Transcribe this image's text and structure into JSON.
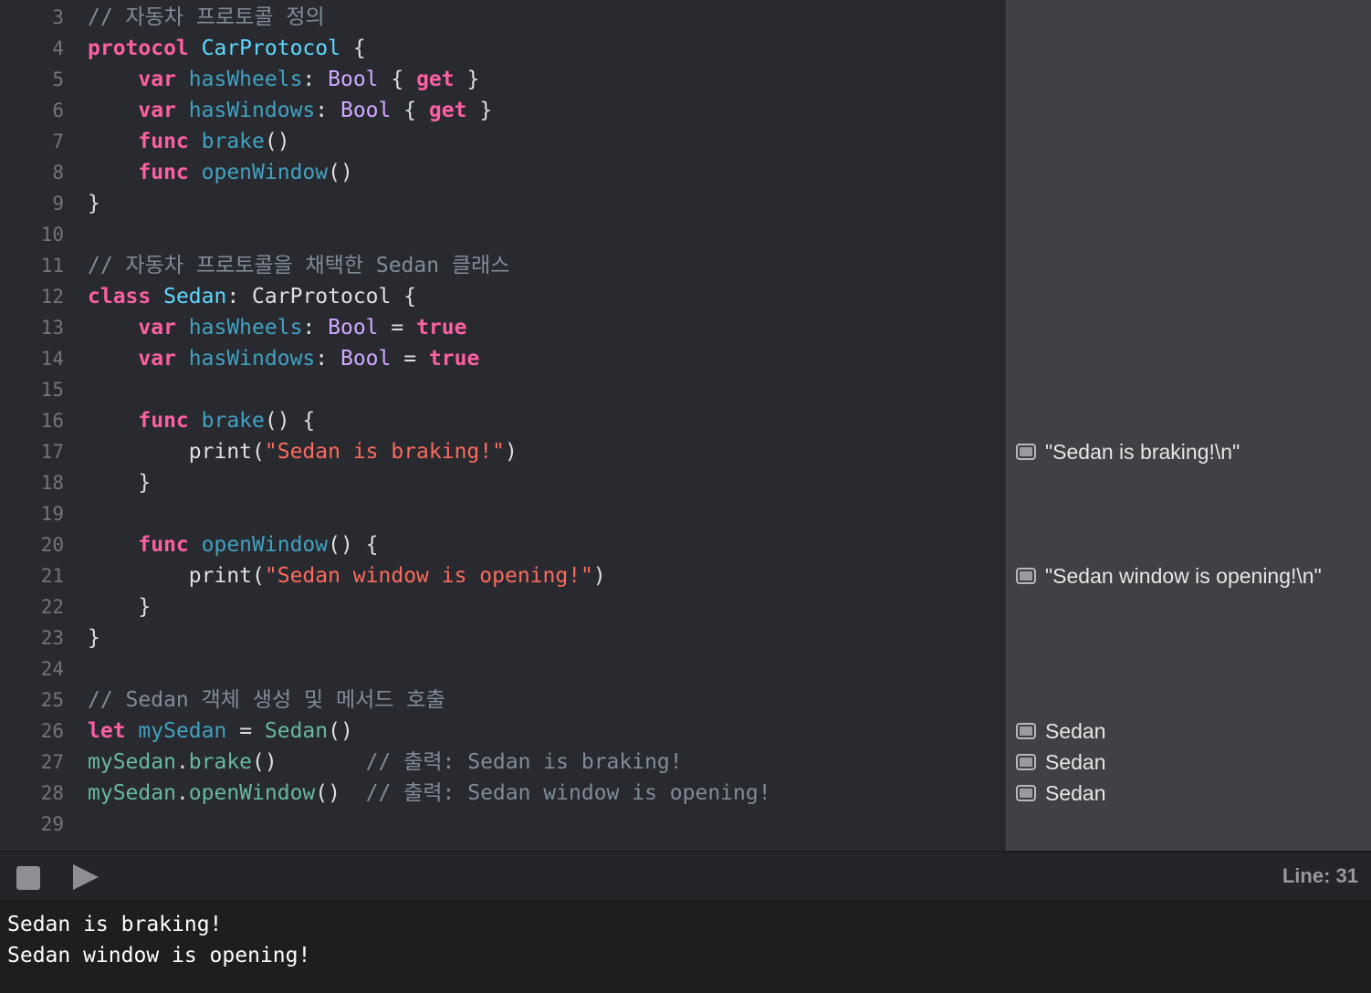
{
  "editor": {
    "lines": [
      {
        "num": "3",
        "tokens": [
          {
            "t": "// 자동차 프로토콜 정의",
            "c": "comment"
          }
        ]
      },
      {
        "num": "4",
        "tokens": [
          {
            "t": "protocol",
            "c": "kw"
          },
          {
            "t": " ",
            "c": "plain"
          },
          {
            "t": "CarProtocol",
            "c": "type"
          },
          {
            "t": " {",
            "c": "plain"
          }
        ]
      },
      {
        "num": "5",
        "tokens": [
          {
            "t": "    ",
            "c": "plain"
          },
          {
            "t": "var",
            "c": "kw"
          },
          {
            "t": " ",
            "c": "plain"
          },
          {
            "t": "hasWheels",
            "c": "prop"
          },
          {
            "t": ": ",
            "c": "plain"
          },
          {
            "t": "Bool",
            "c": "sys"
          },
          {
            "t": " { ",
            "c": "plain"
          },
          {
            "t": "get",
            "c": "kw"
          },
          {
            "t": " }",
            "c": "plain"
          }
        ]
      },
      {
        "num": "6",
        "tokens": [
          {
            "t": "    ",
            "c": "plain"
          },
          {
            "t": "var",
            "c": "kw"
          },
          {
            "t": " ",
            "c": "plain"
          },
          {
            "t": "hasWindows",
            "c": "prop"
          },
          {
            "t": ": ",
            "c": "plain"
          },
          {
            "t": "Bool",
            "c": "sys"
          },
          {
            "t": " { ",
            "c": "plain"
          },
          {
            "t": "get",
            "c": "kw"
          },
          {
            "t": " }",
            "c": "plain"
          }
        ]
      },
      {
        "num": "7",
        "tokens": [
          {
            "t": "    ",
            "c": "plain"
          },
          {
            "t": "func",
            "c": "kw"
          },
          {
            "t": " ",
            "c": "plain"
          },
          {
            "t": "brake",
            "c": "prop"
          },
          {
            "t": "()",
            "c": "plain"
          }
        ]
      },
      {
        "num": "8",
        "tokens": [
          {
            "t": "    ",
            "c": "plain"
          },
          {
            "t": "func",
            "c": "kw"
          },
          {
            "t": " ",
            "c": "plain"
          },
          {
            "t": "openWindow",
            "c": "prop"
          },
          {
            "t": "()",
            "c": "plain"
          }
        ]
      },
      {
        "num": "9",
        "tokens": [
          {
            "t": "}",
            "c": "plain"
          }
        ]
      },
      {
        "num": "10",
        "tokens": []
      },
      {
        "num": "11",
        "tokens": [
          {
            "t": "// 자동차 프로토콜을 채택한 Sedan 클래스",
            "c": "comment"
          }
        ]
      },
      {
        "num": "12",
        "tokens": [
          {
            "t": "class",
            "c": "kw"
          },
          {
            "t": " ",
            "c": "plain"
          },
          {
            "t": "Sedan",
            "c": "type"
          },
          {
            "t": ": CarProtocol {",
            "c": "plain"
          }
        ]
      },
      {
        "num": "13",
        "tokens": [
          {
            "t": "    ",
            "c": "plain"
          },
          {
            "t": "var",
            "c": "kw"
          },
          {
            "t": " ",
            "c": "plain"
          },
          {
            "t": "hasWheels",
            "c": "prop"
          },
          {
            "t": ": ",
            "c": "plain"
          },
          {
            "t": "Bool",
            "c": "sys"
          },
          {
            "t": " = ",
            "c": "plain"
          },
          {
            "t": "true",
            "c": "lit"
          }
        ]
      },
      {
        "num": "14",
        "tokens": [
          {
            "t": "    ",
            "c": "plain"
          },
          {
            "t": "var",
            "c": "kw"
          },
          {
            "t": " ",
            "c": "plain"
          },
          {
            "t": "hasWindows",
            "c": "prop"
          },
          {
            "t": ": ",
            "c": "plain"
          },
          {
            "t": "Bool",
            "c": "sys"
          },
          {
            "t": " = ",
            "c": "plain"
          },
          {
            "t": "true",
            "c": "lit"
          }
        ]
      },
      {
        "num": "15",
        "tokens": []
      },
      {
        "num": "16",
        "tokens": [
          {
            "t": "    ",
            "c": "plain"
          },
          {
            "t": "func",
            "c": "kw"
          },
          {
            "t": " ",
            "c": "plain"
          },
          {
            "t": "brake",
            "c": "prop"
          },
          {
            "t": "() {",
            "c": "plain"
          }
        ]
      },
      {
        "num": "17",
        "tokens": [
          {
            "t": "        print(",
            "c": "plain"
          },
          {
            "t": "\"Sedan is braking!\"",
            "c": "str"
          },
          {
            "t": ")",
            "c": "plain"
          }
        ]
      },
      {
        "num": "18",
        "tokens": [
          {
            "t": "    }",
            "c": "plain"
          }
        ]
      },
      {
        "num": "19",
        "tokens": []
      },
      {
        "num": "20",
        "tokens": [
          {
            "t": "    ",
            "c": "plain"
          },
          {
            "t": "func",
            "c": "kw"
          },
          {
            "t": " ",
            "c": "plain"
          },
          {
            "t": "openWindow",
            "c": "prop"
          },
          {
            "t": "() {",
            "c": "plain"
          }
        ]
      },
      {
        "num": "21",
        "tokens": [
          {
            "t": "        print(",
            "c": "plain"
          },
          {
            "t": "\"Sedan window is opening!\"",
            "c": "str"
          },
          {
            "t": ")",
            "c": "plain"
          }
        ]
      },
      {
        "num": "22",
        "tokens": [
          {
            "t": "    }",
            "c": "plain"
          }
        ]
      },
      {
        "num": "23",
        "tokens": [
          {
            "t": "}",
            "c": "plain"
          }
        ]
      },
      {
        "num": "24",
        "tokens": []
      },
      {
        "num": "25",
        "tokens": [
          {
            "t": "// Sedan 객체 생성 및 메서드 호출",
            "c": "comment"
          }
        ]
      },
      {
        "num": "26",
        "tokens": [
          {
            "t": "let",
            "c": "kw"
          },
          {
            "t": " ",
            "c": "plain"
          },
          {
            "t": "mySedan",
            "c": "prop"
          },
          {
            "t": " = ",
            "c": "plain"
          },
          {
            "t": "Sedan",
            "c": "var"
          },
          {
            "t": "()",
            "c": "plain"
          }
        ]
      },
      {
        "num": "27",
        "tokens": [
          {
            "t": "mySedan",
            "c": "var"
          },
          {
            "t": ".",
            "c": "plain"
          },
          {
            "t": "brake",
            "c": "var"
          },
          {
            "t": "()       ",
            "c": "plain"
          },
          {
            "t": "// 출력: Sedan is braking!",
            "c": "comment"
          }
        ]
      },
      {
        "num": "28",
        "tokens": [
          {
            "t": "mySedan",
            "c": "var"
          },
          {
            "t": ".",
            "c": "plain"
          },
          {
            "t": "openWindow",
            "c": "var"
          },
          {
            "t": "()  ",
            "c": "plain"
          },
          {
            "t": "// 출력: Sedan window is opening!",
            "c": "comment"
          }
        ]
      },
      {
        "num": "29",
        "tokens": []
      }
    ]
  },
  "results": [
    {
      "line": "17",
      "text": "\"Sedan is braking!\\n\""
    },
    {
      "line": "21",
      "text": "\"Sedan window is opening!\\n\""
    },
    {
      "line": "26",
      "text": "Sedan"
    },
    {
      "line": "27",
      "text": "Sedan"
    },
    {
      "line": "28",
      "text": "Sedan"
    }
  ],
  "toolbar": {
    "stop_icon": "stop-icon",
    "run_icon": "play-icon",
    "line_indicator": "Line: 31"
  },
  "console": {
    "lines": [
      "Sedan is braking!",
      "Sedan window is opening!"
    ]
  },
  "colors": {
    "editor_background": "#292a30",
    "results_background": "#404045",
    "keyword": "#fc5fa3",
    "comment": "#7f8c98",
    "type": "#5dd8ff",
    "system_type": "#d0a8ff",
    "property": "#41a1c0",
    "variable": "#67b7a4",
    "string": "#fc6a5d"
  }
}
